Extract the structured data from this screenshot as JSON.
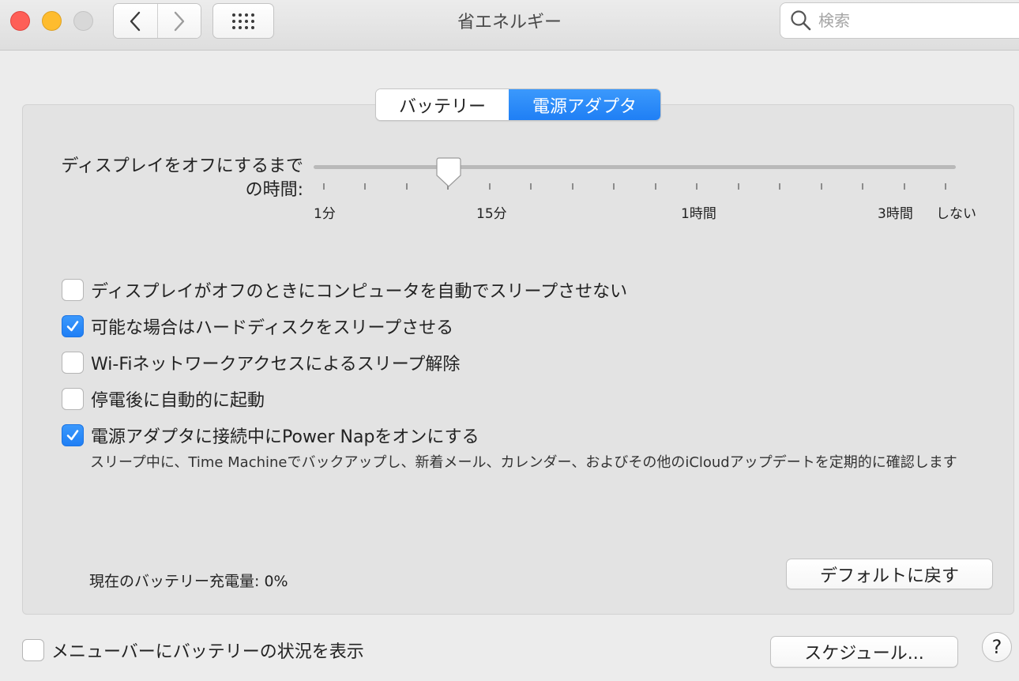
{
  "window": {
    "title": "省エネルギー",
    "search_placeholder": "検索"
  },
  "tabs": [
    {
      "label": "バッテリー",
      "selected": false
    },
    {
      "label": "電源アダプタ",
      "selected": true
    }
  ],
  "slider": {
    "label_line1": "ディスプレイをオフにするまで",
    "label_line2": "の時間:",
    "tick_labels": [
      "1分",
      "15分",
      "1時間",
      "3時間",
      "しない"
    ],
    "tick_count": 16,
    "value": "15分"
  },
  "options": [
    {
      "label": "ディスプレイがオフのときにコンピュータを自動でスリープさせない",
      "checked": false
    },
    {
      "label": "可能な場合はハードディスクをスリープさせる",
      "checked": true
    },
    {
      "label": "Wi-Fiネットワークアクセスによるスリープ解除",
      "checked": false
    },
    {
      "label": "停電後に自動的に起動",
      "checked": false
    },
    {
      "label": "電源アダプタに接続中にPower Napをオンにする",
      "checked": true
    }
  ],
  "power_nap_description": "スリープ中に、Time Machineでバックアップし、新着メール、カレンダー、およびその他のiCloudアップデートを定期的に確認します",
  "battery_status": "現在のバッテリー充電量: 0%",
  "buttons": {
    "default": "デフォルトに戻す",
    "schedule": "スケジュール...",
    "help": "?"
  },
  "menubar_option": {
    "label": "メニューバーにバッテリーの状況を表示",
    "checked": false
  },
  "colors": {
    "accent": "#1f7ff5",
    "close": "#fe5f57",
    "minimize": "#febc2e",
    "zoom_disabled": "#d8d8d8"
  }
}
